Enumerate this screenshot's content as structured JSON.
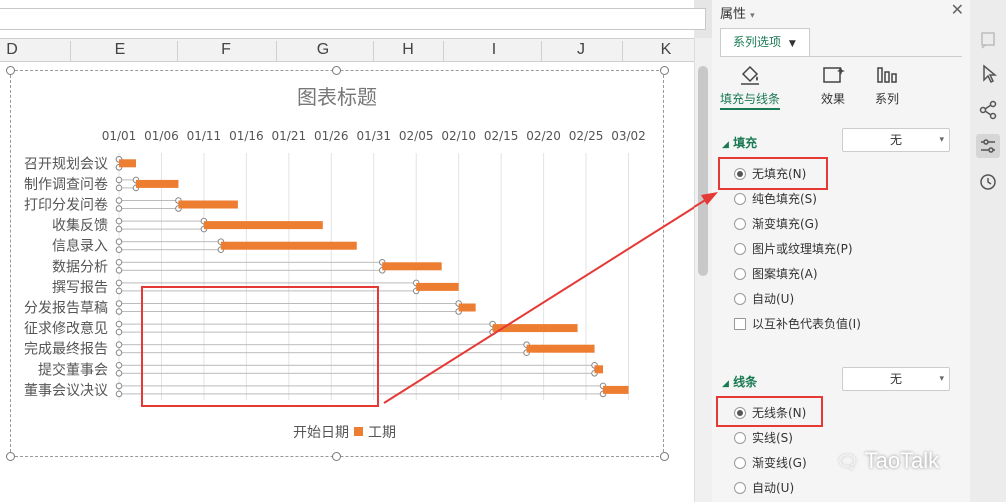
{
  "sheet": {
    "columns": [
      "D",
      "E",
      "F",
      "G",
      "H",
      "I",
      "J",
      "K"
    ]
  },
  "chart_data": {
    "type": "bar",
    "orientation": "horizontal-stacked",
    "title": "图表标题",
    "categories": [
      "召开规划会议",
      "制作调查问卷",
      "打印分发问卷",
      "收集反馈",
      "信息录入",
      "数据分析",
      "撰写报告",
      "分发报告草稿",
      "征求修改意见",
      "完成最终报告",
      "提交董事会",
      "董事会议决议"
    ],
    "x_tick_labels": [
      "01/01",
      "01/06",
      "01/11",
      "01/16",
      "01/21",
      "01/26",
      "01/31",
      "02/05",
      "02/10",
      "02/15",
      "02/20",
      "02/25",
      "03/02"
    ],
    "xlim": [
      "2020-01-01",
      "2020-03-02"
    ],
    "series": [
      {
        "name": "开始日期",
        "fill": "none",
        "values": [
          "2020-01-01",
          "2020-01-03",
          "2020-01-08",
          "2020-01-11",
          "2020-01-13",
          "2020-02-01",
          "2020-02-05",
          "2020-02-10",
          "2020-02-14",
          "2020-02-18",
          "2020-02-26",
          "2020-02-27"
        ]
      },
      {
        "name": "工期",
        "color": "#ed7d31",
        "values": [
          2,
          5,
          7,
          14,
          16,
          7,
          5,
          2,
          10,
          8,
          1,
          3
        ]
      }
    ],
    "legend": {
      "position": "bottom",
      "entries": [
        "开始日期",
        "工期"
      ]
    }
  },
  "panel": {
    "title": "属性",
    "series_tab": "系列选项",
    "subtabs": [
      "填充与线条",
      "效果",
      "系列"
    ],
    "fill": {
      "section": "填充",
      "dropdown": "无",
      "options": [
        "无填充(N)",
        "纯色填充(S)",
        "渐变填充(G)",
        "图片或纹理填充(P)",
        "图案填充(A)",
        "自动(U)"
      ],
      "selected": 0,
      "checkbox": "以互补色代表负值(I)"
    },
    "line": {
      "section": "线条",
      "dropdown": "无",
      "options": [
        "无线条(N)",
        "实线(S)",
        "渐变线(G)",
        "自动(U)"
      ],
      "selected": 0
    }
  },
  "watermark": "TaoTalk"
}
